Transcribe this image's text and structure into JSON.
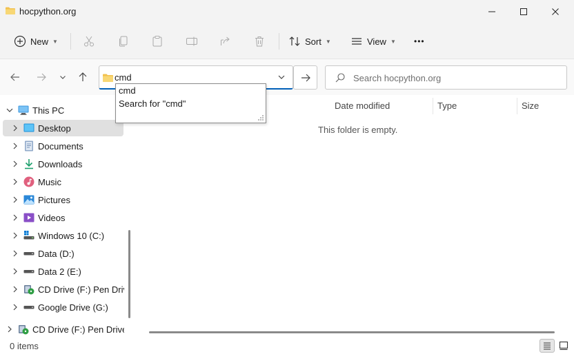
{
  "window": {
    "title": "hocpython.org"
  },
  "toolbar": {
    "new_label": "New",
    "sort_label": "Sort",
    "view_label": "View",
    "more_label": "•••"
  },
  "address": {
    "value": "cmd"
  },
  "search": {
    "placeholder": "Search hocpython.org"
  },
  "suggestions": [
    "cmd",
    "Search for \"cmd\""
  ],
  "sidebar": {
    "items": [
      {
        "label": "This PC",
        "icon": "monitor-icon"
      },
      {
        "label": "Desktop",
        "icon": "desktop-icon"
      },
      {
        "label": "Documents",
        "icon": "documents-icon"
      },
      {
        "label": "Downloads",
        "icon": "download-icon"
      },
      {
        "label": "Music",
        "icon": "music-icon"
      },
      {
        "label": "Pictures",
        "icon": "pictures-icon"
      },
      {
        "label": "Videos",
        "icon": "videos-icon"
      },
      {
        "label": "Windows 10 (C:)",
        "icon": "system-drive-icon"
      },
      {
        "label": "Data (D:)",
        "icon": "drive-icon"
      },
      {
        "label": "Data 2 (E:)",
        "icon": "drive-icon"
      },
      {
        "label": "CD Drive (F:) Pen Driver",
        "icon": "cd-drive-icon"
      },
      {
        "label": "Google Drive (G:)",
        "icon": "drive-icon"
      },
      {
        "label": "CD Drive (F:) Pen Driver",
        "icon": "cd-drive-icon"
      }
    ]
  },
  "columns": [
    "Date modified",
    "Type",
    "Size"
  ],
  "content": {
    "empty_message": "This folder is empty."
  },
  "status": {
    "items_text": "0 items"
  },
  "colors": {
    "accent": "#005fb8",
    "folder": "#f2c14e",
    "selected_bg": "#e0e0e0"
  }
}
